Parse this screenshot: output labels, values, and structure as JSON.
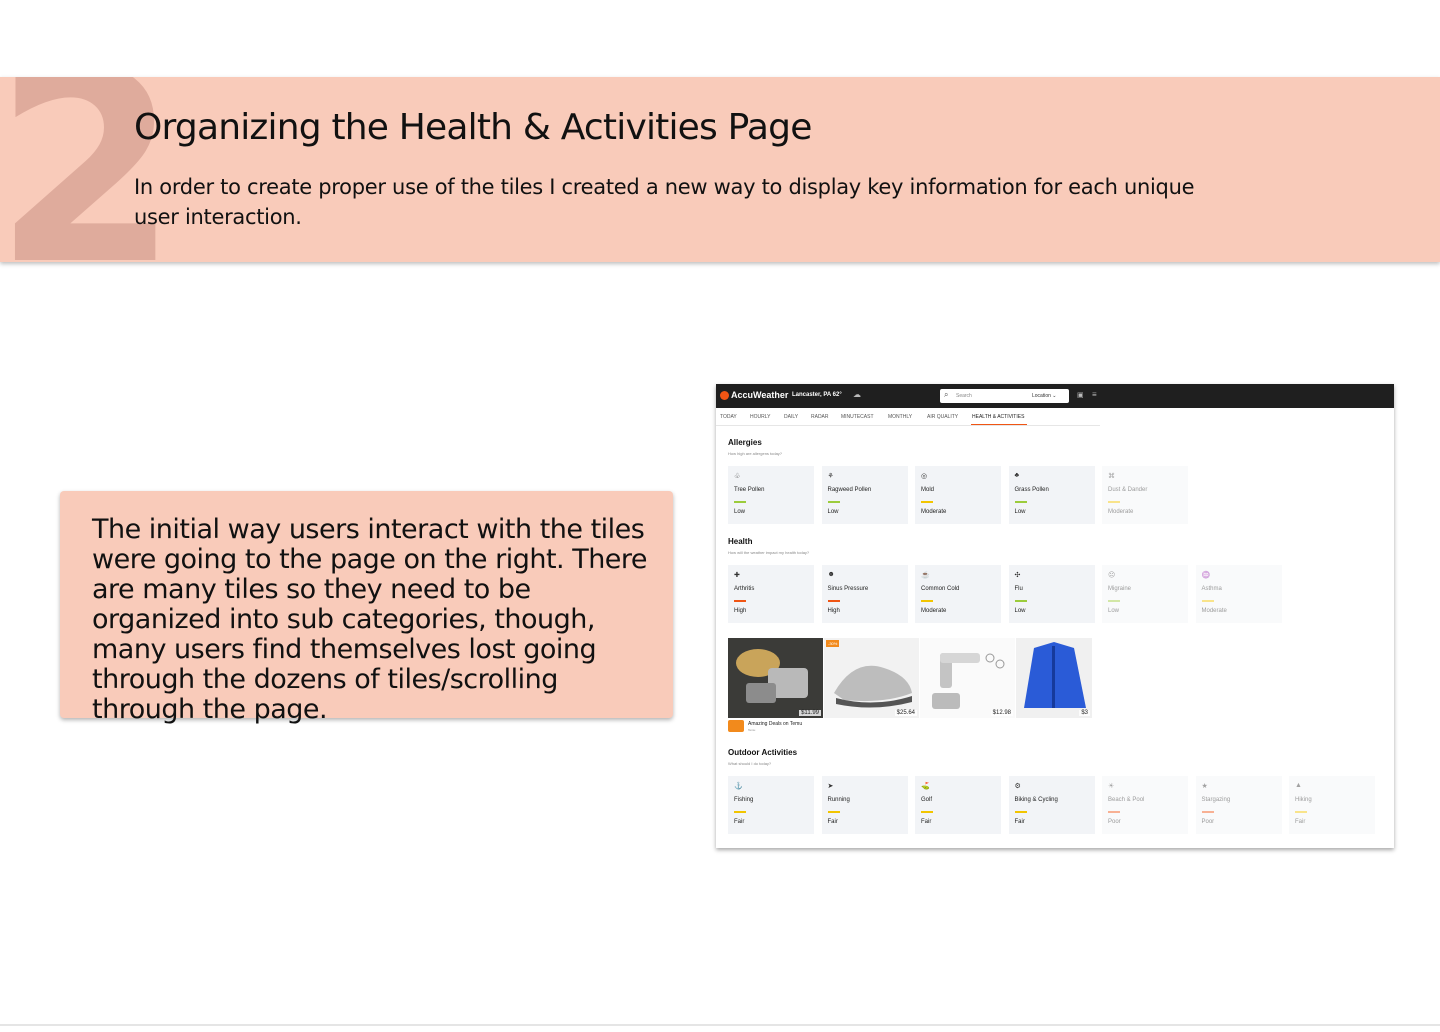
{
  "banner": {
    "number": "2",
    "title": "Organizing the Health & Activities Page",
    "subtitle": "In order to create proper use of the tiles I created a new way to display key information for each unique user interaction."
  },
  "callout": {
    "text": "The initial way users interact with the tiles were going to the page on the right. There are many tiles so they need to be organized into sub categories, though, many users find themselves lost going through the dozens of tiles/scrolling through the page."
  },
  "screenshot": {
    "brand": "AccuWeather",
    "location": "Lancaster, PA 62°",
    "search_placeholder": "Search",
    "location_button": "Location",
    "nav": [
      "TODAY",
      "HOURLY",
      "DAILY",
      "RADAR",
      "MINUTECAST",
      "MONTHLY",
      "AIR QUALITY",
      "HEALTH & ACTIVITIES"
    ],
    "active_nav": "HEALTH & ACTIVITIES",
    "allergies": {
      "title": "Allergies",
      "subtitle": "How high are allergens today?",
      "tiles": [
        {
          "name": "Tree Pollen",
          "level": "Low",
          "icon": "tree-icon",
          "color": "#9ccc3c"
        },
        {
          "name": "Ragweed Pollen",
          "level": "Low",
          "icon": "ragweed-icon",
          "color": "#9ccc3c"
        },
        {
          "name": "Mold",
          "level": "Moderate",
          "icon": "mold-icon",
          "color": "#f2c500"
        },
        {
          "name": "Grass Pollen",
          "level": "Low",
          "icon": "grass-icon",
          "color": "#9ccc3c"
        },
        {
          "name": "Dust & Dander",
          "level": "Moderate",
          "icon": "dust-icon",
          "color": "#f2c500"
        }
      ]
    },
    "health": {
      "title": "Health",
      "subtitle": "How will the weather impact my health today?",
      "tiles": [
        {
          "name": "Arthritis",
          "level": "High",
          "icon": "arthritis-icon",
          "color": "#f05514"
        },
        {
          "name": "Sinus Pressure",
          "level": "High",
          "icon": "sinus-icon",
          "color": "#f05514"
        },
        {
          "name": "Common Cold",
          "level": "Moderate",
          "icon": "cold-icon",
          "color": "#f2c500"
        },
        {
          "name": "Flu",
          "level": "Low",
          "icon": "flu-icon",
          "color": "#9ccc3c"
        },
        {
          "name": "Migraine",
          "level": "Low",
          "icon": "migraine-icon",
          "color": "#9ccc3c"
        },
        {
          "name": "Asthma",
          "level": "Moderate",
          "icon": "asthma-icon",
          "color": "#f2c500"
        }
      ]
    },
    "ad": {
      "prices": [
        "$11.99",
        "$25.64",
        "$12.98",
        "$3"
      ],
      "badge": "-30%",
      "footer": "Amazing Deals on Temu",
      "footer_sub": "Temu"
    },
    "outdoor": {
      "title": "Outdoor Activities",
      "subtitle": "What should I do today?",
      "tiles": [
        {
          "name": "Fishing",
          "level": "Fair",
          "icon": "fishing-icon",
          "color": "#f2c500"
        },
        {
          "name": "Running",
          "level": "Fair",
          "icon": "running-icon",
          "color": "#f2c500"
        },
        {
          "name": "Golf",
          "level": "Fair",
          "icon": "golf-icon",
          "color": "#f2c500"
        },
        {
          "name": "Biking & Cycling",
          "level": "Fair",
          "icon": "biking-icon",
          "color": "#f2c500"
        },
        {
          "name": "Beach & Pool",
          "level": "Poor",
          "icon": "beach-icon",
          "color": "#f05514"
        },
        {
          "name": "Stargazing",
          "level": "Poor",
          "icon": "stargazing-icon",
          "color": "#f05514"
        },
        {
          "name": "Hiking",
          "level": "Fair",
          "icon": "hiking-icon",
          "color": "#f2c500"
        }
      ]
    }
  }
}
